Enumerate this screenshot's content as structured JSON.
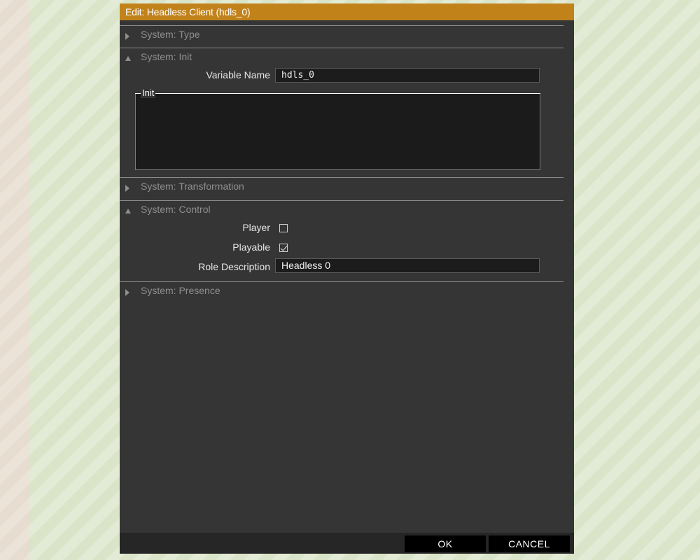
{
  "window": {
    "title": "Edit: Headless Client (hdls_0)"
  },
  "sections": {
    "type": {
      "label": "System: Type",
      "expanded": false
    },
    "init": {
      "label": "System: Init",
      "expanded": true,
      "variable_name_label": "Variable Name",
      "variable_name_value": "hdls_0",
      "init_group_label": "Init",
      "init_code": ""
    },
    "transformation": {
      "label": "System: Transformation",
      "expanded": false
    },
    "control": {
      "label": "System: Control",
      "expanded": true,
      "player_label": "Player",
      "player_checked": false,
      "playable_label": "Playable",
      "playable_checked": true,
      "role_description_label": "Role Description",
      "role_description_value": "Headless 0"
    },
    "presence": {
      "label": "System: Presence",
      "expanded": false
    }
  },
  "buttons": {
    "ok": "OK",
    "cancel": "CANCEL"
  },
  "colors": {
    "title_bar": "#c1821a",
    "dialog_bg": "#353535",
    "input_bg": "#1c1c1c"
  }
}
